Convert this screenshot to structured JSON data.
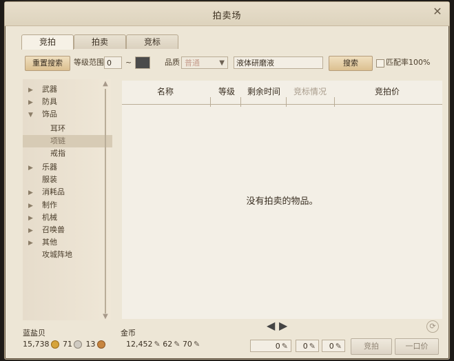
{
  "window": {
    "title": "拍卖场",
    "close_label": "✕"
  },
  "tabs": [
    {
      "label": "竞拍",
      "active": true
    },
    {
      "label": "拍卖"
    },
    {
      "label": "竞标"
    }
  ],
  "toolbar": {
    "reset_label": "重置搜索",
    "level_label": "等级范围",
    "level_min": "0",
    "level_sep": "~",
    "level_max": "",
    "quality_label": "品质",
    "quality_value": "普通",
    "search_input": "液体研磨液",
    "search_button": "搜索",
    "match_label": "匹配率100%"
  },
  "categories": [
    {
      "label": "武器",
      "expandable": true
    },
    {
      "label": "防具",
      "expandable": true
    },
    {
      "label": "饰品",
      "expandable": true,
      "expanded": true
    },
    {
      "label": "耳环",
      "sub": true
    },
    {
      "label": "项链",
      "sub": true,
      "selected": true
    },
    {
      "label": "戒指",
      "sub": true
    },
    {
      "label": "乐器",
      "expandable": true
    },
    {
      "label": "服装"
    },
    {
      "label": "消耗品",
      "expandable": true
    },
    {
      "label": "制作",
      "expandable": true
    },
    {
      "label": "机械",
      "expandable": true
    },
    {
      "label": "召唤兽",
      "expandable": true
    },
    {
      "label": "其他",
      "expandable": true
    },
    {
      "label": "攻城阵地"
    }
  ],
  "table": {
    "headers": [
      "名称",
      "等级",
      "剩余时间",
      "竞标情况",
      "竞拍价"
    ],
    "empty_message": "没有拍卖的物品。"
  },
  "currency": {
    "blue_shell": {
      "label": "蓝盐贝",
      "gold": "15,738",
      "silver": "71",
      "copper": "13"
    },
    "gold_coin": {
      "label": "金币",
      "gold": "12,452",
      "silver": "62",
      "copper": "70"
    }
  },
  "bid": {
    "gold": "0",
    "silver": "0",
    "copper": "0",
    "bid_button": "竞拍",
    "buyout_button": "一口价"
  },
  "colors": {
    "accent": "#dcc090",
    "background": "#ede6d6"
  }
}
